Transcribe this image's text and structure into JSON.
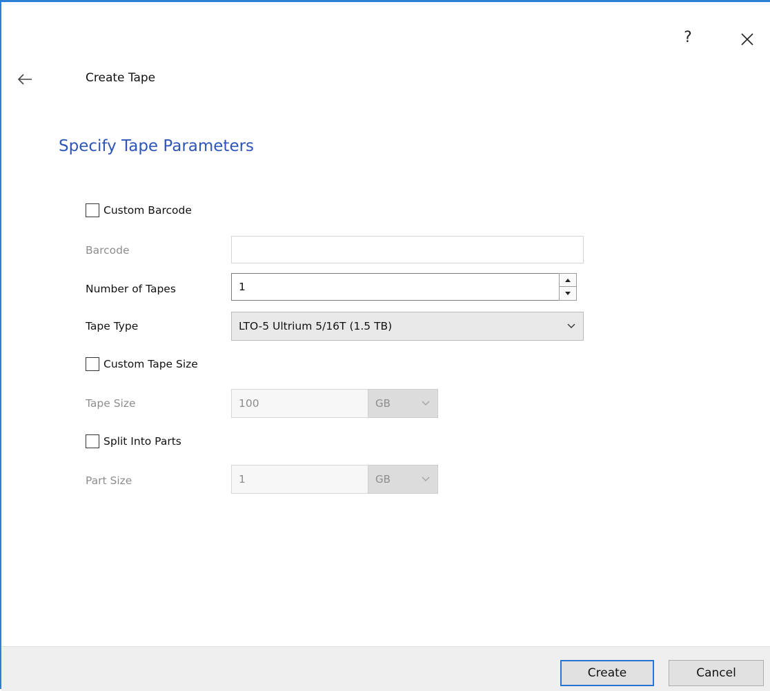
{
  "window": {
    "help_label": "?",
    "title": "Create Tape"
  },
  "icons": {
    "back": "arrow-left-icon",
    "close": "close-icon",
    "spin_up": "triangle-up-icon",
    "spin_down": "triangle-down-icon",
    "dropdown": "chevron-down-icon"
  },
  "colors": {
    "accent": "#2b7fd6",
    "heading": "#2e55b8",
    "disabled_text": "#8d8d8d",
    "footer_bg": "#efefef"
  },
  "page": {
    "heading": "Specify Tape Parameters"
  },
  "form": {
    "custom_barcode": {
      "label": "Custom Barcode",
      "checked": false
    },
    "barcode": {
      "label": "Barcode",
      "value": "",
      "enabled": false
    },
    "number_of_tapes": {
      "label": "Number of Tapes",
      "value": "1"
    },
    "tape_type": {
      "label": "Tape Type",
      "selected": "LTO-5 Ultrium 5/16T (1.5 TB)"
    },
    "custom_tape_size": {
      "label": "Custom Tape Size",
      "checked": false
    },
    "tape_size": {
      "label": "Tape Size",
      "value": "100",
      "unit": "GB",
      "enabled": false
    },
    "split_into_parts": {
      "label": "Split Into Parts",
      "checked": false
    },
    "part_size": {
      "label": "Part Size",
      "value": "1",
      "unit": "GB",
      "enabled": false
    }
  },
  "footer": {
    "create_label": "Create",
    "cancel_label": "Cancel"
  }
}
